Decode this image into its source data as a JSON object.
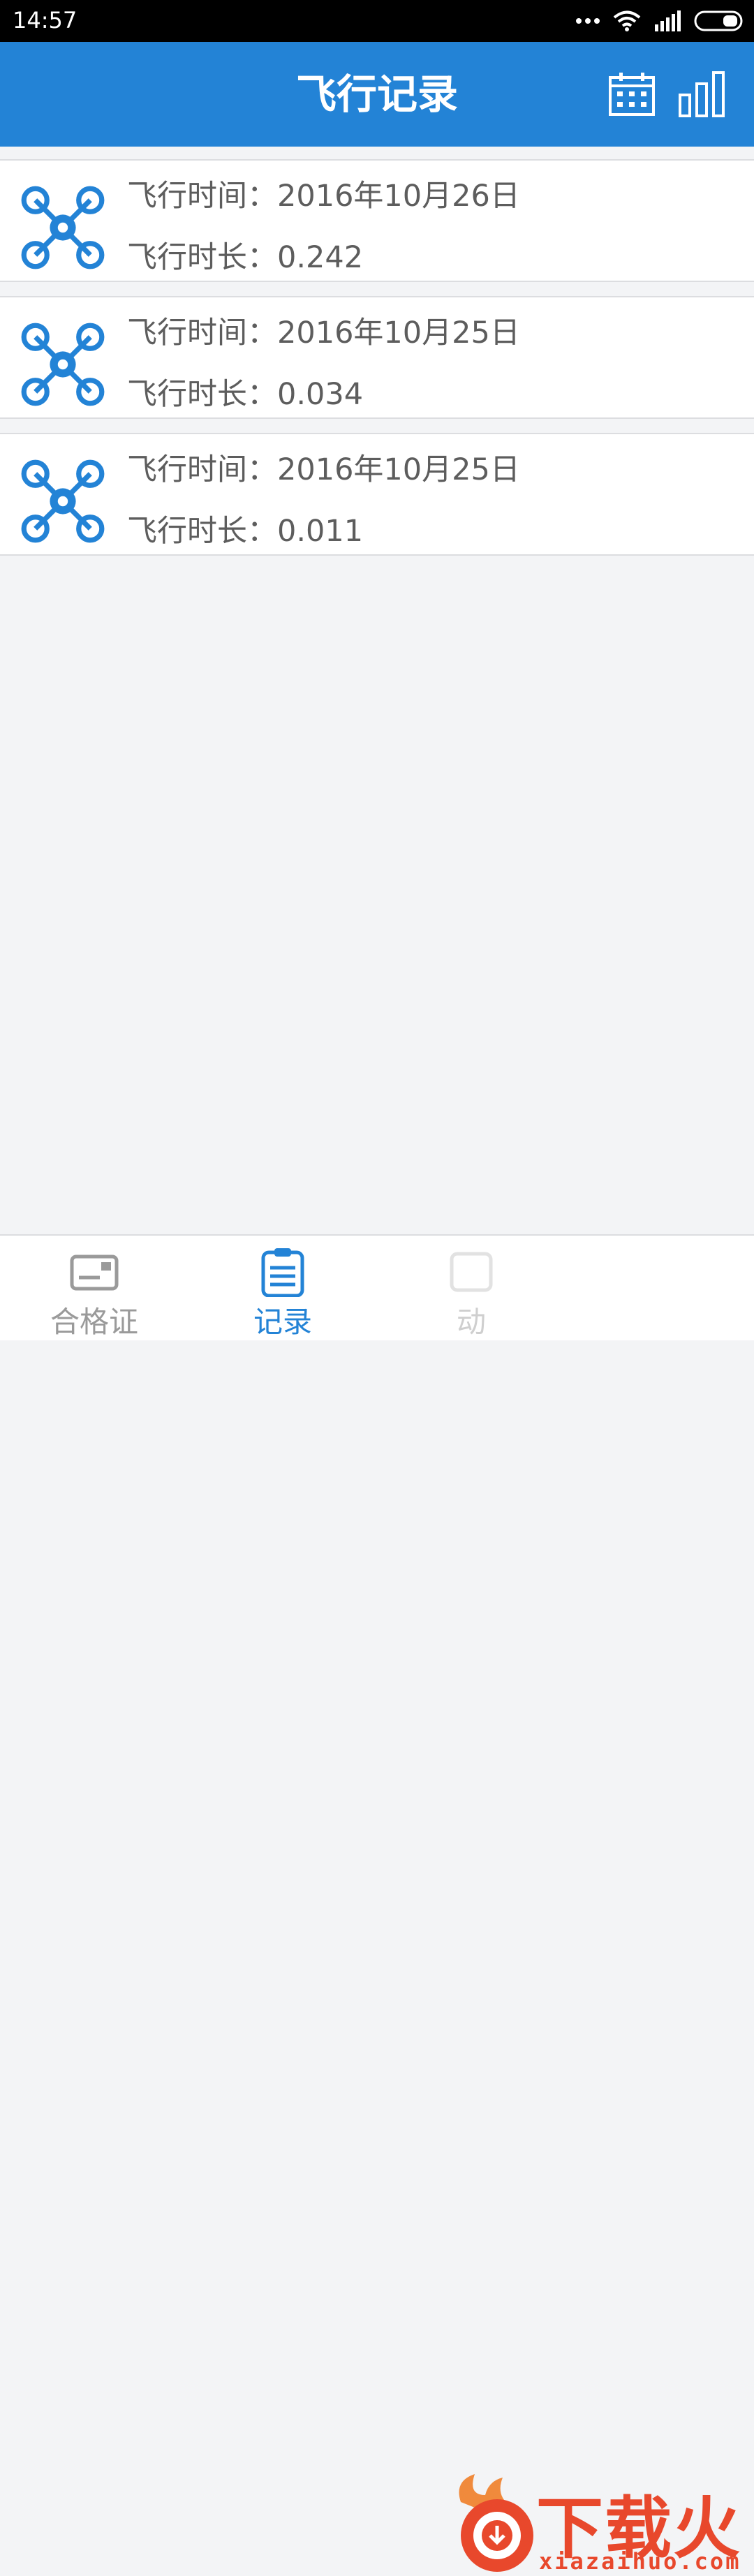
{
  "status_bar": {
    "time": "14:57"
  },
  "header": {
    "title": "飞行记录"
  },
  "records": [
    {
      "time_label": "飞行时间：",
      "time_value": "2016年10月26日",
      "duration_label": "飞行时长：",
      "duration_value": "0.242"
    },
    {
      "time_label": "飞行时间：",
      "time_value": "2016年10月25日",
      "duration_label": "飞行时长：",
      "duration_value": "0.034"
    },
    {
      "time_label": "飞行时间：",
      "time_value": "2016年10月25日",
      "duration_label": "飞行时长：",
      "duration_value": "0.011"
    }
  ],
  "bottom_nav": {
    "tabs": [
      {
        "label": "合格证",
        "icon": "certificate-card-icon",
        "active": false
      },
      {
        "label": "记录",
        "icon": "clipboard-icon",
        "active": true
      },
      {
        "label": "动",
        "icon": "dynamic-icon",
        "active": false
      }
    ]
  },
  "watermark": {
    "brand": "下载火",
    "url": "xiazaihuo.com"
  },
  "colors": {
    "primary": "#2383d6",
    "background": "#f3f4f6",
    "text": "#5d5d5d",
    "watermark": "#e8482c"
  }
}
